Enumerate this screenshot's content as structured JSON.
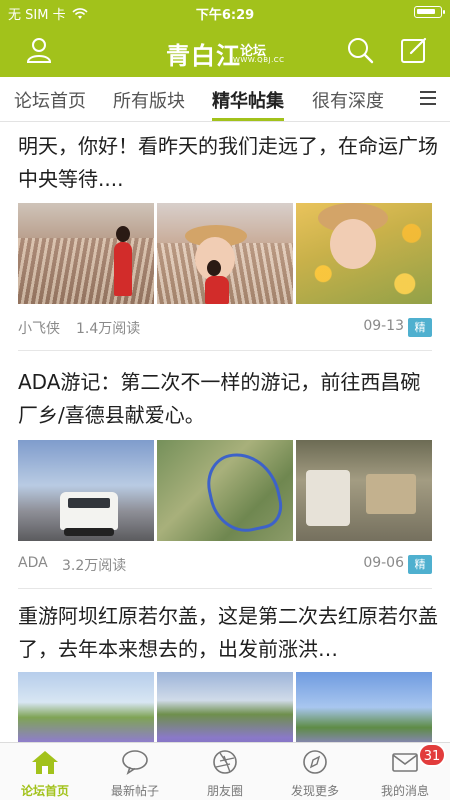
{
  "status_bar": {
    "carrier": "无 SIM 卡",
    "time": "下午6:29"
  },
  "navbar": {
    "logo_main": "青白江",
    "logo_sub": "论坛",
    "logo_domain": "WWW.QBJ.CC",
    "brand_color": "#a2c21b"
  },
  "tabs": [
    {
      "label": "论坛首页",
      "active": false
    },
    {
      "label": "所有版块",
      "active": false
    },
    {
      "label": "精华帖集",
      "active": true
    },
    {
      "label": "很有深度",
      "active": false
    }
  ],
  "posts": [
    {
      "title": "明天，你好！看昨天的我们走远了，在命运广场中央等待....",
      "author": "小飞侠",
      "reads": "1.4万阅读",
      "date": "09-13",
      "badge": "精"
    },
    {
      "title": "ADA游记：第二次不一样的游记，前往西昌碗厂乡/喜德县献爱心。",
      "author": "ADA",
      "reads": "3.2万阅读",
      "date": "09-06",
      "badge": "精"
    },
    {
      "title": "重游阿坝红原若尔盖，这是第二次去红原若尔盖了，去年本来想去的，出发前涨洪…",
      "author": "",
      "reads": "",
      "date": "",
      "badge": ""
    }
  ],
  "bottom_tabs": [
    {
      "label": "论坛首页",
      "icon": "home-icon",
      "active": true
    },
    {
      "label": "最新帖子",
      "icon": "chat-bubble-icon",
      "active": false
    },
    {
      "label": "朋友圈",
      "icon": "aperture-icon",
      "active": false
    },
    {
      "label": "发现更多",
      "icon": "compass-icon",
      "active": false
    },
    {
      "label": "我的消息",
      "icon": "mail-icon",
      "active": false
    }
  ],
  "unread_count": "31"
}
